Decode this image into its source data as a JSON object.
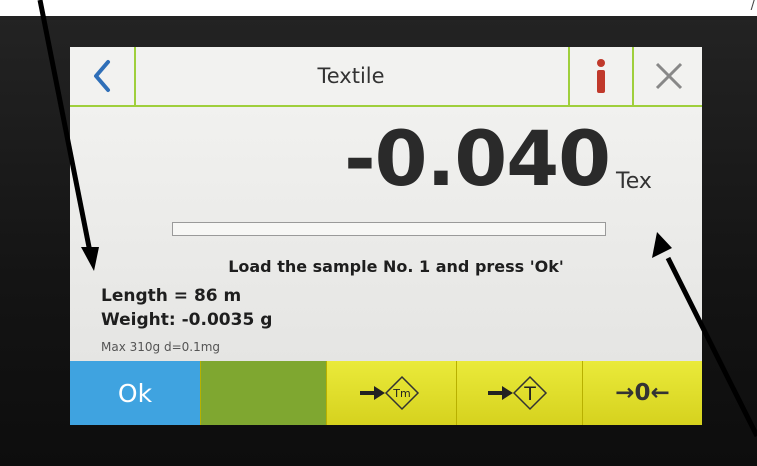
{
  "corner_mark": "/",
  "header": {
    "back_icon": "chevron-left-icon",
    "title": "Textile",
    "info_label": "i",
    "close_icon": "close-icon"
  },
  "reading": {
    "value": "-0.040",
    "unit": "Tex",
    "progress_fraction": 0
  },
  "message": "Load the sample No. 1 and press 'Ok'",
  "sample": {
    "length": "Length = 86 m",
    "weight": "Weight: -0.0035 g"
  },
  "capacity": "Max 310g   d=0.1mg",
  "footer": {
    "ok_label": "Ok",
    "tare_memory_icon": "tare-memory-icon",
    "tare_memory_label": "Tm",
    "tare_icon": "tare-icon",
    "tare_label": "T",
    "zero_label": "→0←"
  },
  "colors": {
    "accent_green": "#9fcf3c",
    "ok_blue": "#3fa3e0",
    "function_yellow": "#e2de2c",
    "blank_green": "#7fa730",
    "info_red": "#c0392b"
  }
}
